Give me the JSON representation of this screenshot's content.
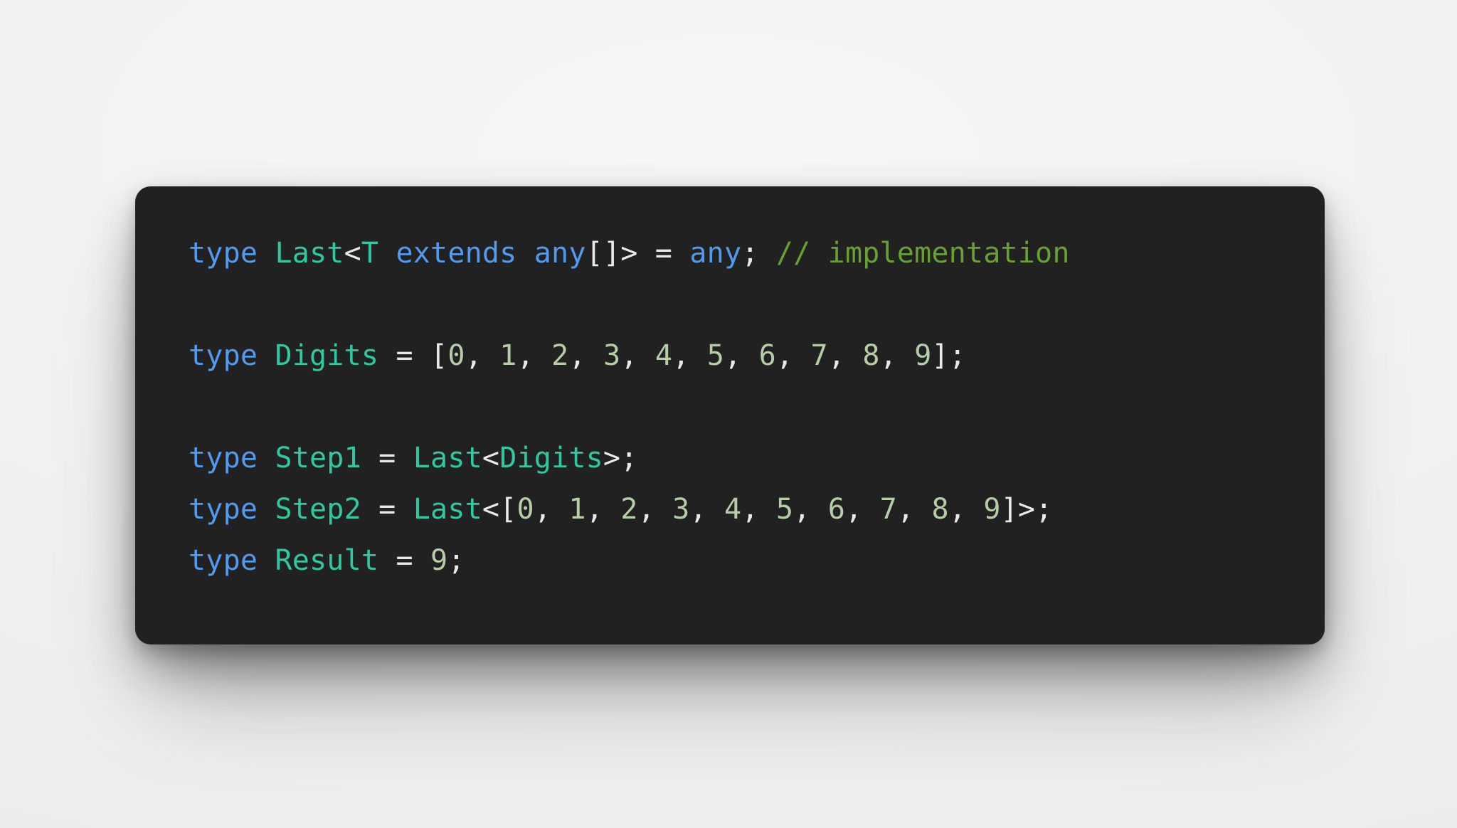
{
  "app": {
    "kind": "code-snippet-image",
    "language": "TypeScript",
    "background_color": "#f1f1f1"
  },
  "card": {
    "background_color": "#212121",
    "corner_radius_px": 22,
    "has_drop_shadow": true
  },
  "theme": {
    "keyword_color": "#519aee",
    "type_color": "#2ec9a0",
    "number_color": "#b5cea8",
    "punctuation_color": "#e9e9e9",
    "comment_color": "#68a033",
    "foreground_color": "#e6e6e6"
  },
  "code": {
    "plain_text": "type Last<T extends any[]> = any; // implementation\n\ntype Digits = [0, 1, 2, 3, 4, 5, 6, 7, 8, 9];\n\ntype Step1 = Last<Digits>;\ntype Step2 = Last<[0, 1, 2, 3, 4, 5, 6, 7, 8, 9]>;\ntype Result = 9;",
    "lines": [
      {
        "id": "line-1",
        "text": "type Last<T extends any[]> = any; // implementation",
        "tokens": [
          {
            "t": "type",
            "c": "keyword"
          },
          {
            "t": " ",
            "c": "plain"
          },
          {
            "t": "Last",
            "c": "type"
          },
          {
            "t": "<",
            "c": "punct"
          },
          {
            "t": "T",
            "c": "type"
          },
          {
            "t": " ",
            "c": "plain"
          },
          {
            "t": "extends",
            "c": "keyword"
          },
          {
            "t": " ",
            "c": "plain"
          },
          {
            "t": "any",
            "c": "builtin"
          },
          {
            "t": "[]",
            "c": "punct"
          },
          {
            "t": ">",
            "c": "punct"
          },
          {
            "t": " ",
            "c": "plain"
          },
          {
            "t": "=",
            "c": "operator"
          },
          {
            "t": " ",
            "c": "plain"
          },
          {
            "t": "any",
            "c": "builtin"
          },
          {
            "t": ";",
            "c": "punct"
          },
          {
            "t": " ",
            "c": "plain"
          },
          {
            "t": "// implementation",
            "c": "comment"
          }
        ]
      },
      {
        "id": "line-2",
        "text": "",
        "tokens": []
      },
      {
        "id": "line-3",
        "text": "type Digits = [0, 1, 2, 3, 4, 5, 6, 7, 8, 9];",
        "tokens": [
          {
            "t": "type",
            "c": "keyword"
          },
          {
            "t": " ",
            "c": "plain"
          },
          {
            "t": "Digits",
            "c": "type"
          },
          {
            "t": " ",
            "c": "plain"
          },
          {
            "t": "=",
            "c": "operator"
          },
          {
            "t": " ",
            "c": "plain"
          },
          {
            "t": "[",
            "c": "punct"
          },
          {
            "t": "0",
            "c": "number"
          },
          {
            "t": ", ",
            "c": "punct"
          },
          {
            "t": "1",
            "c": "number"
          },
          {
            "t": ", ",
            "c": "punct"
          },
          {
            "t": "2",
            "c": "number"
          },
          {
            "t": ", ",
            "c": "punct"
          },
          {
            "t": "3",
            "c": "number"
          },
          {
            "t": ", ",
            "c": "punct"
          },
          {
            "t": "4",
            "c": "number"
          },
          {
            "t": ", ",
            "c": "punct"
          },
          {
            "t": "5",
            "c": "number"
          },
          {
            "t": ", ",
            "c": "punct"
          },
          {
            "t": "6",
            "c": "number"
          },
          {
            "t": ", ",
            "c": "punct"
          },
          {
            "t": "7",
            "c": "number"
          },
          {
            "t": ", ",
            "c": "punct"
          },
          {
            "t": "8",
            "c": "number"
          },
          {
            "t": ", ",
            "c": "punct"
          },
          {
            "t": "9",
            "c": "number"
          },
          {
            "t": "];",
            "c": "punct"
          }
        ]
      },
      {
        "id": "line-4",
        "text": "",
        "tokens": []
      },
      {
        "id": "line-5",
        "text": "type Step1 = Last<Digits>;",
        "tokens": [
          {
            "t": "type",
            "c": "keyword"
          },
          {
            "t": " ",
            "c": "plain"
          },
          {
            "t": "Step1",
            "c": "type"
          },
          {
            "t": " ",
            "c": "plain"
          },
          {
            "t": "=",
            "c": "operator"
          },
          {
            "t": " ",
            "c": "plain"
          },
          {
            "t": "Last",
            "c": "type"
          },
          {
            "t": "<",
            "c": "punct"
          },
          {
            "t": "Digits",
            "c": "type"
          },
          {
            "t": ">;",
            "c": "punct"
          }
        ]
      },
      {
        "id": "line-6",
        "text": "type Step2 = Last<[0, 1, 2, 3, 4, 5, 6, 7, 8, 9]>;",
        "tokens": [
          {
            "t": "type",
            "c": "keyword"
          },
          {
            "t": " ",
            "c": "plain"
          },
          {
            "t": "Step2",
            "c": "type"
          },
          {
            "t": " ",
            "c": "plain"
          },
          {
            "t": "=",
            "c": "operator"
          },
          {
            "t": " ",
            "c": "plain"
          },
          {
            "t": "Last",
            "c": "type"
          },
          {
            "t": "<[",
            "c": "punct"
          },
          {
            "t": "0",
            "c": "number"
          },
          {
            "t": ", ",
            "c": "punct"
          },
          {
            "t": "1",
            "c": "number"
          },
          {
            "t": ", ",
            "c": "punct"
          },
          {
            "t": "2",
            "c": "number"
          },
          {
            "t": ", ",
            "c": "punct"
          },
          {
            "t": "3",
            "c": "number"
          },
          {
            "t": ", ",
            "c": "punct"
          },
          {
            "t": "4",
            "c": "number"
          },
          {
            "t": ", ",
            "c": "punct"
          },
          {
            "t": "5",
            "c": "number"
          },
          {
            "t": ", ",
            "c": "punct"
          },
          {
            "t": "6",
            "c": "number"
          },
          {
            "t": ", ",
            "c": "punct"
          },
          {
            "t": "7",
            "c": "number"
          },
          {
            "t": ", ",
            "c": "punct"
          },
          {
            "t": "8",
            "c": "number"
          },
          {
            "t": ", ",
            "c": "punct"
          },
          {
            "t": "9",
            "c": "number"
          },
          {
            "t": "]>;",
            "c": "punct"
          }
        ]
      },
      {
        "id": "line-7",
        "text": "type Result = 9;",
        "tokens": [
          {
            "t": "type",
            "c": "keyword"
          },
          {
            "t": " ",
            "c": "plain"
          },
          {
            "t": "Result",
            "c": "type"
          },
          {
            "t": " ",
            "c": "plain"
          },
          {
            "t": "=",
            "c": "operator"
          },
          {
            "t": " ",
            "c": "plain"
          },
          {
            "t": "9",
            "c": "number"
          },
          {
            "t": ";",
            "c": "punct"
          }
        ]
      }
    ]
  }
}
